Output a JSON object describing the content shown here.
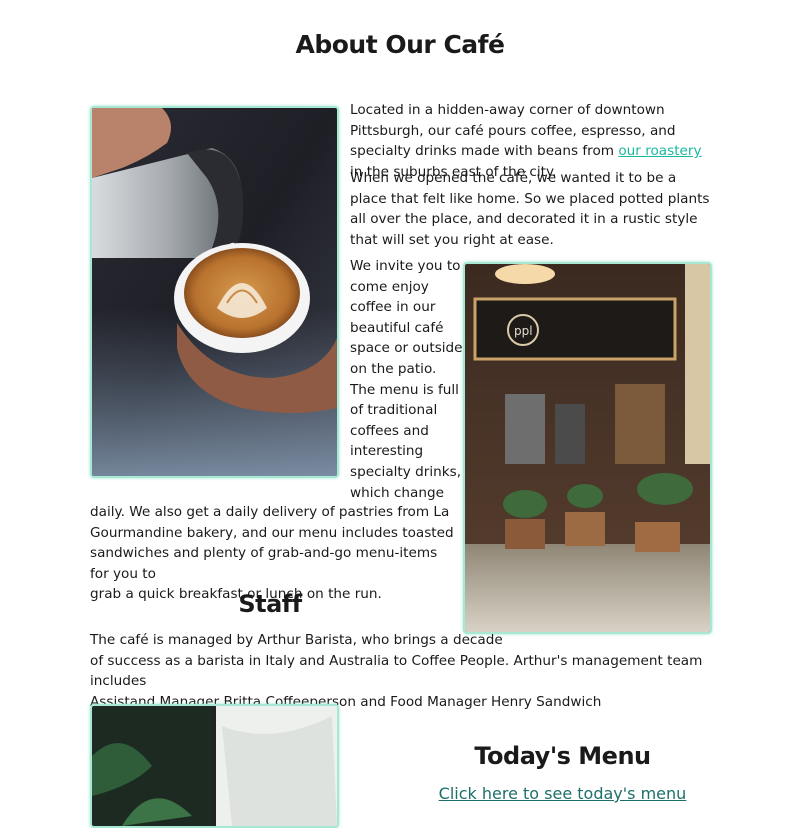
{
  "page": {
    "title": "About Our Café"
  },
  "about": {
    "p1_before": "Located in a hidden-away corner of downtown Pittsburgh, our café pours coffee, espresso, and specialty drinks made with beans from ",
    "p1_link": "our roastery",
    "p1_after": " in the suburbs east of the city.",
    "p2": "When we opened the café, we wanted it to be a place that felt like home. So we placed potted plants all over the place, and decorated it in a rustic style that will set you right at ease.",
    "p3_narrow": [
      "We invite you to",
      "come enjoy",
      "coffee in our",
      "beautiful café",
      "space or outside",
      "on the patio.",
      "The menu is full",
      "of traditional",
      "coffees and",
      "interesting",
      "specialty drinks,",
      "which change"
    ],
    "p3_wide": [
      "daily. We also get a daily delivery of pastries from La",
      "Gourmandine bakery, and our menu includes toasted",
      "sandwiches and plenty of grab-and-go menu-items for you to",
      "grab a quick breakfast or lunch on the run."
    ]
  },
  "staff": {
    "title": "Staff",
    "lines": [
      "The café is managed by Arthur Barista, who brings a decade",
      "of success as a barista in Italy and Australia to Coffee People. Arthur's management team includes",
      "Assistand Manager Britta Coffeeperson and Food Manager Henry Sandwich"
    ]
  },
  "menu": {
    "title": "Today's Menu",
    "link": "Click here to see today's menu"
  },
  "colors": {
    "accent_link": "#1bb7a0",
    "image_border": "#a6e8d4",
    "menu_link": "#1d6f6a"
  }
}
